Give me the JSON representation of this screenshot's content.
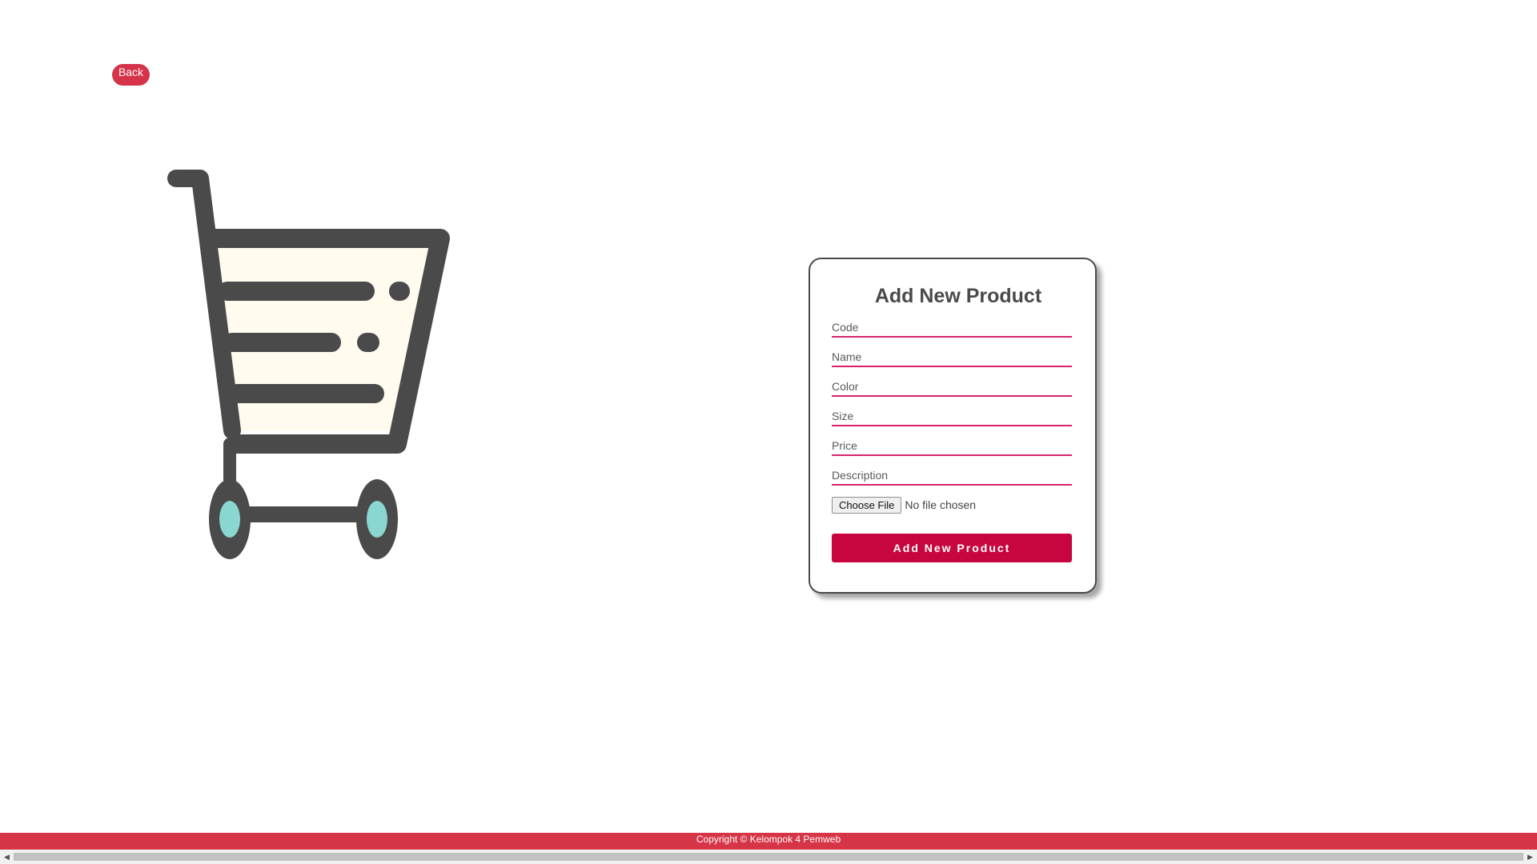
{
  "back_label": "Back",
  "form": {
    "title": "Add New Product",
    "fields": {
      "code": "Code",
      "name": "Name",
      "color": "Color",
      "size": "Size",
      "price": "Price",
      "description": "Description"
    },
    "file_button": "Choose File",
    "file_status": "No file chosen",
    "submit_label": "Add New Product"
  },
  "footer": {
    "copyright": "Copyright © Kelompok 4 Pemweb"
  },
  "colors": {
    "accent": "#d53349",
    "submit": "#c7063f",
    "field_underline": "#d6236a",
    "cart_body": "#4a4a4a",
    "cart_fill": "#fffbee",
    "cart_wheel": "#8ad6d0"
  },
  "icons": {
    "illustration": "shopping-cart-icon"
  }
}
